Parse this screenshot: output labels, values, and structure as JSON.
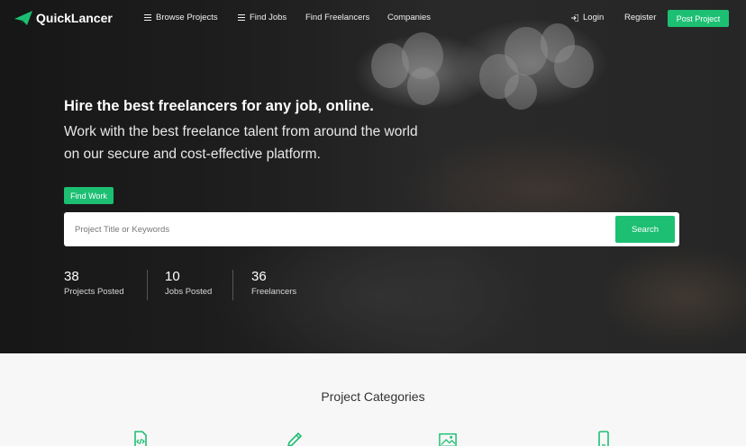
{
  "brand": {
    "name": "QuickLancer",
    "accent": "#1dbf73"
  },
  "nav": {
    "browse_projects": "Browse Projects",
    "find_jobs": "Find Jobs",
    "find_freelancers": "Find Freelancers",
    "companies": "Companies",
    "login": "Login",
    "register": "Register",
    "post_project": "Post Project"
  },
  "hero": {
    "headline": "Hire the best freelancers for any job, online.",
    "subline": "Work with the best freelance talent from around the world on our secure and cost-effective platform.",
    "find_work_label": "Find Work"
  },
  "search": {
    "placeholder": "Project Title or Keywords",
    "button_label": "Search"
  },
  "stats": [
    {
      "value": "38",
      "label": "Projects Posted"
    },
    {
      "value": "10",
      "label": "Jobs Posted"
    },
    {
      "value": "36",
      "label": "Freelancers"
    }
  ],
  "categories": {
    "title": "Project Categories",
    "icons": [
      "code-file-icon",
      "pencil-icon",
      "image-icon",
      "mobile-icon"
    ]
  }
}
